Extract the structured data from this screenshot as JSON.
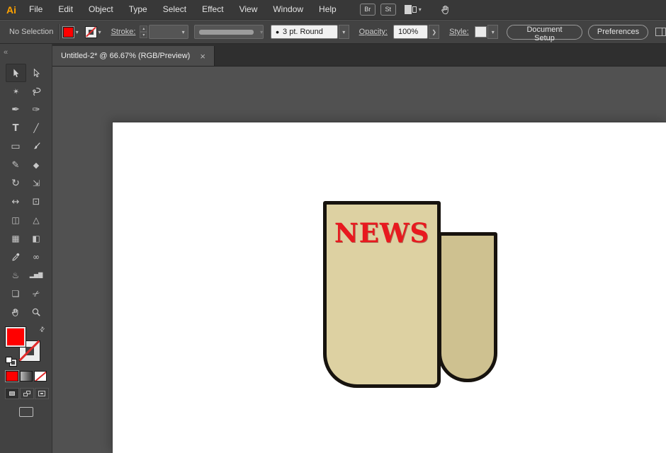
{
  "colors": {
    "logo_amber": "#ffa200",
    "fill_red": "#ff0000",
    "headline_red": "#e8191f",
    "paper_front": "#ddd1a2",
    "paper_back": "#cec190",
    "artwork_outline": "#17130e"
  },
  "glyphs": {
    "chevron_down": "▾",
    "chevron_up": "▴",
    "chevron_right": "❯",
    "collapse_left": "«",
    "swap": "⇄",
    "bullet": "•",
    "close": "×"
  },
  "menubar": {
    "logo": "Ai",
    "items": [
      "File",
      "Edit",
      "Object",
      "Type",
      "Select",
      "Effect",
      "View",
      "Window",
      "Help"
    ],
    "bridge_label": "Br",
    "stock_label": "St"
  },
  "controlbar": {
    "selection_status": "No Selection",
    "stroke_label": "Stroke:",
    "brush_name": "3 pt. Round",
    "opacity_label": "Opacity:",
    "opacity_value": "100%",
    "style_label": "Style:",
    "document_setup_label": "Document Setup",
    "preferences_label": "Preferences"
  },
  "tabbar": {
    "tab_title": "Untitled-2* @ 66.67% (RGB/Preview)"
  },
  "toolbar": {
    "tools": [
      {
        "name": "selection-tool",
        "glyph": ""
      },
      {
        "name": "direct-selection-tool",
        "glyph": ""
      },
      {
        "name": "magic-wand-tool",
        "glyph": "✶"
      },
      {
        "name": "lasso-tool",
        "glyph": ""
      },
      {
        "name": "pen-tool",
        "glyph": "✒"
      },
      {
        "name": "curvature-tool",
        "glyph": "✑"
      },
      {
        "name": "type-tool",
        "glyph": "T"
      },
      {
        "name": "line-segment-tool",
        "glyph": "╱"
      },
      {
        "name": "rectangle-tool",
        "glyph": "▭"
      },
      {
        "name": "paintbrush-tool",
        "glyph": ""
      },
      {
        "name": "pencil-tool",
        "glyph": "✎"
      },
      {
        "name": "eraser-tool",
        "glyph": "◆"
      },
      {
        "name": "rotate-tool",
        "glyph": "↻"
      },
      {
        "name": "scale-tool",
        "glyph": "⇲"
      },
      {
        "name": "width-tool",
        "glyph": "↔"
      },
      {
        "name": "free-transform-tool",
        "glyph": "⊡"
      },
      {
        "name": "shape-builder-tool",
        "glyph": "◫"
      },
      {
        "name": "perspective-grid-tool",
        "glyph": "△"
      },
      {
        "name": "mesh-tool",
        "glyph": "▦"
      },
      {
        "name": "gradient-tool",
        "glyph": "◧"
      },
      {
        "name": "eyedropper-tool",
        "glyph": ""
      },
      {
        "name": "blend-tool",
        "glyph": "∞"
      },
      {
        "name": "symbol-sprayer-tool",
        "glyph": "♨"
      },
      {
        "name": "column-graph-tool",
        "glyph": "▂▅▇"
      },
      {
        "name": "artboard-tool",
        "glyph": "❏"
      },
      {
        "name": "slice-tool",
        "glyph": "✂"
      },
      {
        "name": "hand-tool",
        "glyph": ""
      },
      {
        "name": "zoom-tool",
        "glyph": ""
      }
    ]
  },
  "canvas": {
    "artwork": {
      "headline": "NEWS"
    }
  }
}
